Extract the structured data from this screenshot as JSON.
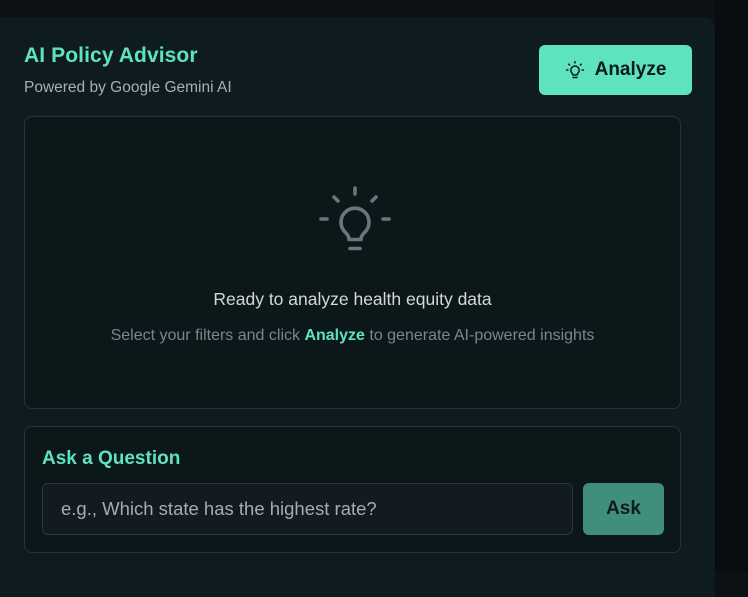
{
  "advisor": {
    "title": "AI Policy Advisor",
    "subtitle": "Powered by Google Gemini AI",
    "analyze_label": "Analyze",
    "analyze_icon": "lightbulb-icon"
  },
  "empty_state": {
    "icon": "lightbulb-icon",
    "heading": "Ready to analyze health equity data",
    "hint_before": "Select your filters and click ",
    "hint_highlight": "Analyze",
    "hint_after": " to generate AI-powered insights"
  },
  "question": {
    "title": "Ask a Question",
    "placeholder": "e.g., Which state has the highest rate?",
    "value": "",
    "ask_label": "Ask"
  },
  "colors": {
    "accent": "#5ee3bf",
    "panel_bg": "#0f1c1f",
    "card_bg": "#0c171a",
    "ask_button": "#3f8f7c",
    "border": "#263338"
  }
}
